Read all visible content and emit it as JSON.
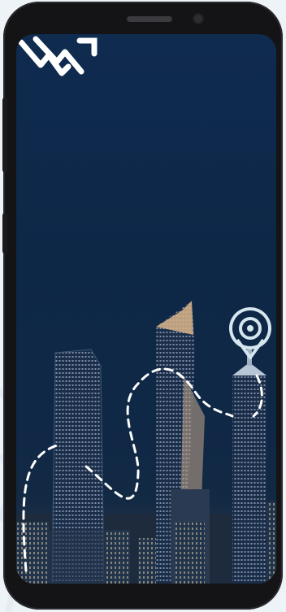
{
  "app": {
    "logo_icon": "brand-logo-icon",
    "location_pin_icon": "location-pin-icon"
  },
  "colors": {
    "screen_top": "#0f2b4f",
    "logo": "#ffffff",
    "pin": "#cfe3ee",
    "path_dashes": "#ffffff"
  }
}
